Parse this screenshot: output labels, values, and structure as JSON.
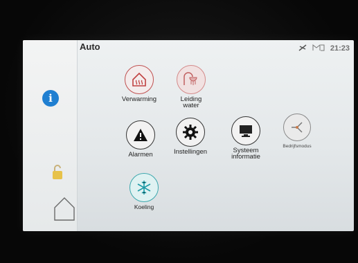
{
  "header": {
    "mode": "Auto",
    "time": "21:23"
  },
  "tiles": [
    {
      "line1": "Verwarming",
      "line2": ""
    },
    {
      "line1": "Leiding",
      "line2": "water"
    },
    {
      "line1": "Alarmen",
      "line2": ""
    },
    {
      "line1": "Instellingen",
      "line2": ""
    },
    {
      "line1": "Systeem",
      "line2": "informatie"
    },
    {
      "line1": "Bedrijfsmodus",
      "line2": ""
    },
    {
      "line1": "Koeling",
      "line2": ""
    }
  ],
  "icons": {
    "info": "info-icon",
    "status1": "network-icon",
    "status2": "signal-icon",
    "lock": "lock-icon",
    "home": "home-icon"
  },
  "colors": {
    "info_blue": "#1f7fd1",
    "heating_red": "#c04040",
    "cooling_teal": "#2a9fa8",
    "lock_yellow": "#e7c24a"
  }
}
